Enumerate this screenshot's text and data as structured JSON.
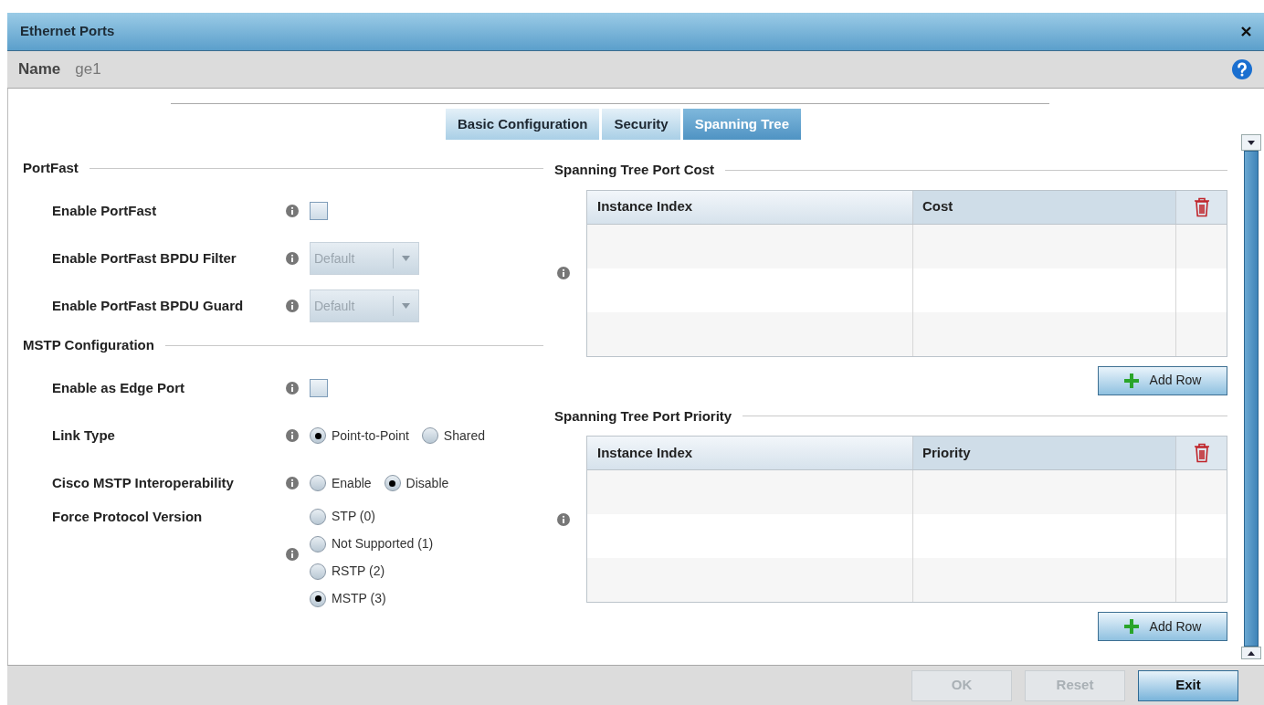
{
  "window": {
    "title": "Ethernet Ports"
  },
  "name": {
    "label": "Name",
    "value": "ge1"
  },
  "tabs": [
    {
      "label": "Basic Configuration",
      "selected": false
    },
    {
      "label": "Security",
      "selected": false
    },
    {
      "label": "Spanning Tree",
      "selected": true
    }
  ],
  "left_sections": [
    {
      "title": "PortFast",
      "fields": [
        {
          "kind": "checkbox",
          "label": "Enable PortFast",
          "checked": false
        },
        {
          "kind": "select",
          "label": "Enable PortFast BPDU Filter",
          "value": "Default",
          "disabled": true
        },
        {
          "kind": "select",
          "label": "Enable PortFast BPDU Guard",
          "value": "Default",
          "disabled": true
        }
      ]
    },
    {
      "title": "MSTP Configuration",
      "fields": [
        {
          "kind": "checkbox",
          "label": "Enable as Edge Port",
          "checked": false
        },
        {
          "kind": "radio",
          "label": "Link Type",
          "options": [
            {
              "label": "Point-to-Point",
              "selected": true
            },
            {
              "label": "Shared",
              "selected": false
            }
          ]
        },
        {
          "kind": "radio",
          "label": "Cisco MSTP Interoperability",
          "options": [
            {
              "label": "Enable",
              "selected": false
            },
            {
              "label": "Disable",
              "selected": true
            }
          ]
        },
        {
          "kind": "radio-list",
          "label": "Force Protocol Version",
          "options": [
            {
              "label": "STP (0)",
              "selected": false
            },
            {
              "label": "Not Supported (1)",
              "selected": false
            },
            {
              "label": "RSTP (2)",
              "selected": false
            },
            {
              "label": "MSTP (3)",
              "selected": true
            }
          ]
        }
      ]
    }
  ],
  "tables": [
    {
      "title": "Spanning Tree Port Cost",
      "columns": [
        "Instance Index",
        "Cost"
      ],
      "add_button": "Add Row"
    },
    {
      "title": "Spanning Tree Port Priority",
      "columns": [
        "Instance Index",
        "Priority"
      ],
      "add_button": "Add Row"
    }
  ],
  "footer_buttons": [
    {
      "label": "OK",
      "disabled": true
    },
    {
      "label": "Reset",
      "disabled": true
    },
    {
      "label": "Exit",
      "disabled": false
    }
  ]
}
